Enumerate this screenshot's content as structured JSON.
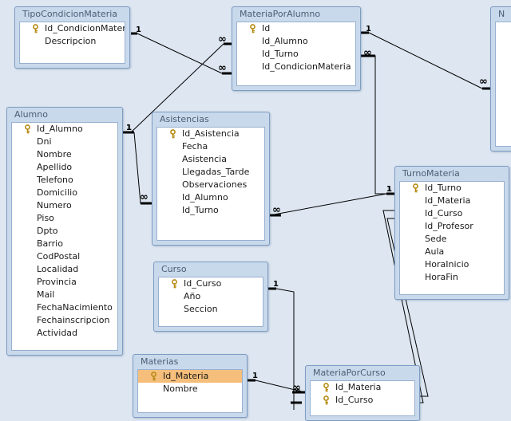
{
  "tables": [
    {
      "id": "TipoCondicionMateria",
      "title": "TipoCondicionMateria",
      "fields": [
        {
          "name": "Id_CondicionMater",
          "pk": true
        },
        {
          "name": "Descripcion",
          "pk": false
        }
      ]
    },
    {
      "id": "MateriaPorAlumno",
      "title": "MateriaPorAlumno",
      "fields": [
        {
          "name": "Id",
          "pk": true
        },
        {
          "name": "Id_Alumno",
          "pk": false
        },
        {
          "name": "Id_Turno",
          "pk": false
        },
        {
          "name": "Id_CondicionMateria",
          "pk": false
        }
      ]
    },
    {
      "id": "N",
      "title": "N",
      "fields": []
    },
    {
      "id": "Alumno",
      "title": "Alumno",
      "fields": [
        {
          "name": "Id_Alumno",
          "pk": true
        },
        {
          "name": "Dni",
          "pk": false
        },
        {
          "name": "Nombre",
          "pk": false
        },
        {
          "name": "Apellido",
          "pk": false
        },
        {
          "name": "Telefono",
          "pk": false
        },
        {
          "name": "Domicilio",
          "pk": false
        },
        {
          "name": "Numero",
          "pk": false
        },
        {
          "name": "Piso",
          "pk": false
        },
        {
          "name": "Dpto",
          "pk": false
        },
        {
          "name": "Barrio",
          "pk": false
        },
        {
          "name": "CodPostal",
          "pk": false
        },
        {
          "name": "Localidad",
          "pk": false
        },
        {
          "name": "Provincia",
          "pk": false
        },
        {
          "name": "Mail",
          "pk": false
        },
        {
          "name": "FechaNacimiento",
          "pk": false
        },
        {
          "name": "Fechainscripcion",
          "pk": false
        },
        {
          "name": "Actividad",
          "pk": false
        }
      ]
    },
    {
      "id": "Asistencias",
      "title": "Asistencias",
      "fields": [
        {
          "name": "Id_Asistencia",
          "pk": true
        },
        {
          "name": "Fecha",
          "pk": false
        },
        {
          "name": "Asistencia",
          "pk": false
        },
        {
          "name": "Llegadas_Tarde",
          "pk": false
        },
        {
          "name": "Observaciones",
          "pk": false
        },
        {
          "name": "Id_Alumno",
          "pk": false
        },
        {
          "name": "Id_Turno",
          "pk": false
        }
      ]
    },
    {
      "id": "TurnoMateria",
      "title": "TurnoMateria",
      "fields": [
        {
          "name": "Id_Turno",
          "pk": true
        },
        {
          "name": "Id_Materia",
          "pk": false
        },
        {
          "name": "Id_Curso",
          "pk": false
        },
        {
          "name": "Id_Profesor",
          "pk": false
        },
        {
          "name": "Sede",
          "pk": false
        },
        {
          "name": "Aula",
          "pk": false
        },
        {
          "name": "HoraInicio",
          "pk": false
        },
        {
          "name": "HoraFin",
          "pk": false
        }
      ]
    },
    {
      "id": "Curso",
      "title": "Curso",
      "fields": [
        {
          "name": "Id_Curso",
          "pk": true
        },
        {
          "name": "Año",
          "pk": false
        },
        {
          "name": "Seccion",
          "pk": false
        }
      ]
    },
    {
      "id": "Materias",
      "title": "Materias",
      "fields": [
        {
          "name": "Id_Materia",
          "pk": true,
          "selected": true
        },
        {
          "name": "Nombre",
          "pk": false
        }
      ]
    },
    {
      "id": "MateriaPorCurso",
      "title": "MateriaPorCurso",
      "fields": [
        {
          "name": "Id_Materia",
          "pk": true
        },
        {
          "name": "Id_Curso",
          "pk": true
        }
      ]
    }
  ],
  "relationships": [
    {
      "from": "TipoCondicionMateria",
      "to": "MateriaPorAlumno",
      "one": "1",
      "many": "∞"
    },
    {
      "from": "Alumno",
      "to": "MateriaPorAlumno",
      "one": "1",
      "many": "∞"
    },
    {
      "from": "MateriaPorAlumno",
      "to": "N",
      "one": "1",
      "many": "∞"
    },
    {
      "from": "TurnoMateria",
      "to": "MateriaPorAlumno",
      "one": "1",
      "many": "∞"
    },
    {
      "from": "Alumno",
      "to": "Asistencias",
      "one": "1",
      "many": "∞"
    },
    {
      "from": "TurnoMateria",
      "to": "Asistencias",
      "one": "1",
      "many": "∞"
    },
    {
      "from": "Curso",
      "to": "MateriaPorCurso",
      "one": "1",
      "many": "∞"
    },
    {
      "from": "Materias",
      "to": "MateriaPorCurso",
      "one": "1",
      "many": "∞"
    },
    {
      "from": "TurnoMateria",
      "to": "MateriaPorCurso",
      "one": "",
      "many": ""
    }
  ],
  "colors": {
    "canvas": "#dde6f1",
    "table_frame": "#c9d9ec",
    "selected_field": "#f6be7b",
    "link": "#000000"
  }
}
